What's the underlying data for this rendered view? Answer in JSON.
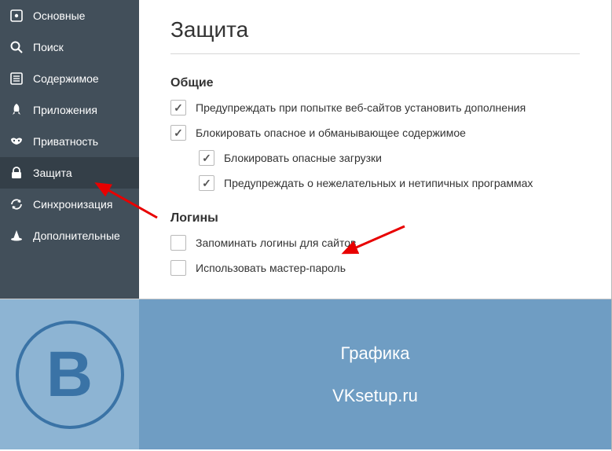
{
  "sidebar": {
    "items": [
      {
        "label": "Основные"
      },
      {
        "label": "Поиск"
      },
      {
        "label": "Содержимое"
      },
      {
        "label": "Приложения"
      },
      {
        "label": "Приватность"
      },
      {
        "label": "Защита"
      },
      {
        "label": "Синхронизация"
      },
      {
        "label": "Дополнительные"
      }
    ]
  },
  "page": {
    "title": "Защита"
  },
  "sections": {
    "general": {
      "title": "Общие",
      "warn_addons": "Предупреждать при попытке веб-сайтов установить дополнения",
      "block_dangerous": "Блокировать опасное и обманывающее содержимое",
      "block_dangerous_downloads": "Блокировать опасные загрузки",
      "warn_unwanted": "Предупреждать о нежелательных и нетипичных программах"
    },
    "logins": {
      "title": "Логины",
      "remember_logins": "Запоминать логины для сайтов",
      "use_master_password": "Использовать мастер-пароль"
    }
  },
  "banner": {
    "letter": "В",
    "line1": "Графика",
    "line2": "VKsetup.ru"
  }
}
